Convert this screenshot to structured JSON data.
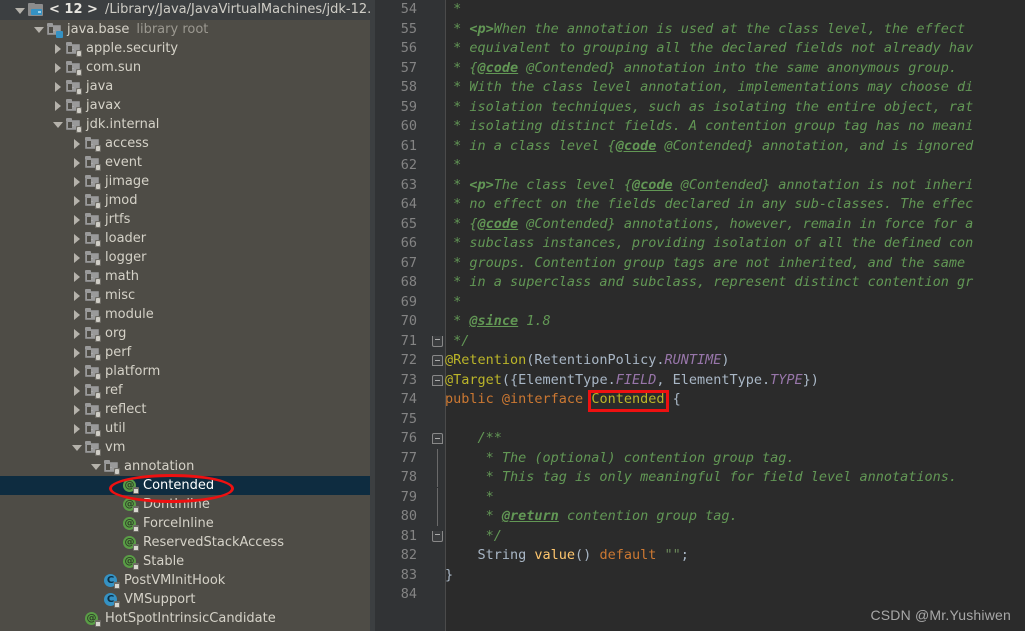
{
  "project_tree": {
    "header": {
      "label": "< 12 >",
      "path": "/Library/Java/JavaVirtualMachines/jdk-12.",
      "icon": "module-icon",
      "arrow": "down"
    },
    "items": [
      {
        "indent": 1,
        "arrow": "down",
        "icon": "library-root-icon",
        "label": "java.base",
        "suffix": "library root"
      },
      {
        "indent": 2,
        "arrow": "right",
        "icon": "package-icon",
        "label": "apple.security",
        "suffix": ""
      },
      {
        "indent": 2,
        "arrow": "right",
        "icon": "package-icon",
        "label": "com.sun",
        "suffix": ""
      },
      {
        "indent": 2,
        "arrow": "right",
        "icon": "package-icon",
        "label": "java",
        "suffix": ""
      },
      {
        "indent": 2,
        "arrow": "right",
        "icon": "package-icon",
        "label": "javax",
        "suffix": ""
      },
      {
        "indent": 2,
        "arrow": "down",
        "icon": "package-icon",
        "label": "jdk.internal",
        "suffix": ""
      },
      {
        "indent": 3,
        "arrow": "right",
        "icon": "package-icon",
        "label": "access",
        "suffix": ""
      },
      {
        "indent": 3,
        "arrow": "right",
        "icon": "package-icon",
        "label": "event",
        "suffix": ""
      },
      {
        "indent": 3,
        "arrow": "right",
        "icon": "package-icon",
        "label": "jimage",
        "suffix": ""
      },
      {
        "indent": 3,
        "arrow": "right",
        "icon": "package-icon",
        "label": "jmod",
        "suffix": ""
      },
      {
        "indent": 3,
        "arrow": "right",
        "icon": "package-icon",
        "label": "jrtfs",
        "suffix": ""
      },
      {
        "indent": 3,
        "arrow": "right",
        "icon": "package-icon",
        "label": "loader",
        "suffix": ""
      },
      {
        "indent": 3,
        "arrow": "right",
        "icon": "package-icon",
        "label": "logger",
        "suffix": ""
      },
      {
        "indent": 3,
        "arrow": "right",
        "icon": "package-icon",
        "label": "math",
        "suffix": ""
      },
      {
        "indent": 3,
        "arrow": "right",
        "icon": "package-icon",
        "label": "misc",
        "suffix": ""
      },
      {
        "indent": 3,
        "arrow": "right",
        "icon": "package-icon",
        "label": "module",
        "suffix": ""
      },
      {
        "indent": 3,
        "arrow": "right",
        "icon": "package-icon",
        "label": "org",
        "suffix": ""
      },
      {
        "indent": 3,
        "arrow": "right",
        "icon": "package-icon",
        "label": "perf",
        "suffix": ""
      },
      {
        "indent": 3,
        "arrow": "right",
        "icon": "package-icon",
        "label": "platform",
        "suffix": ""
      },
      {
        "indent": 3,
        "arrow": "right",
        "icon": "package-icon",
        "label": "ref",
        "suffix": ""
      },
      {
        "indent": 3,
        "arrow": "right",
        "icon": "package-icon",
        "label": "reflect",
        "suffix": ""
      },
      {
        "indent": 3,
        "arrow": "right",
        "icon": "package-icon",
        "label": "util",
        "suffix": ""
      },
      {
        "indent": 3,
        "arrow": "down",
        "icon": "package-icon",
        "label": "vm",
        "suffix": ""
      },
      {
        "indent": 4,
        "arrow": "down",
        "icon": "package-icon",
        "label": "annotation",
        "suffix": ""
      },
      {
        "indent": 5,
        "arrow": "none",
        "icon": "annotation-icon",
        "label": "Contended",
        "suffix": "",
        "selected": true
      },
      {
        "indent": 5,
        "arrow": "none",
        "icon": "annotation-icon",
        "label": "DontInline",
        "suffix": ""
      },
      {
        "indent": 5,
        "arrow": "none",
        "icon": "annotation-icon",
        "label": "ForceInline",
        "suffix": ""
      },
      {
        "indent": 5,
        "arrow": "none",
        "icon": "annotation-icon",
        "label": "ReservedStackAccess",
        "suffix": ""
      },
      {
        "indent": 5,
        "arrow": "none",
        "icon": "annotation-icon",
        "label": "Stable",
        "suffix": ""
      },
      {
        "indent": 4,
        "arrow": "none",
        "icon": "class-icon",
        "label": "PostVMInitHook",
        "suffix": ""
      },
      {
        "indent": 4,
        "arrow": "none",
        "icon": "class-icon",
        "label": "VMSupport",
        "suffix": ""
      },
      {
        "indent": 3,
        "arrow": "none",
        "icon": "annotation-icon",
        "label": "HotSpotIntrinsicCandidate",
        "suffix": ""
      }
    ]
  },
  "editor": {
    "first_line_number": 54,
    "lines": [
      {
        "n": 54,
        "fold": "",
        "tokens": [
          {
            "t": " * ",
            "c": "c-doc"
          }
        ]
      },
      {
        "n": 55,
        "fold": "",
        "tokens": [
          {
            "t": " * ",
            "c": "c-doc"
          },
          {
            "t": "<p>",
            "c": "c-doc-html"
          },
          {
            "t": "When the annotation is used at the class level, the effect",
            "c": "c-doc"
          }
        ]
      },
      {
        "n": 56,
        "fold": "",
        "tokens": [
          {
            "t": " * equivalent to grouping all the declared fields not already hav",
            "c": "c-doc"
          }
        ]
      },
      {
        "n": 57,
        "fold": "",
        "tokens": [
          {
            "t": " * {",
            "c": "c-doc"
          },
          {
            "t": "@code",
            "c": "c-doc-tag"
          },
          {
            "t": " @Contended} annotation into the same anonymous group.",
            "c": "c-doc"
          }
        ]
      },
      {
        "n": 58,
        "fold": "",
        "tokens": [
          {
            "t": " * With the class level annotation, implementations may choose di",
            "c": "c-doc"
          }
        ]
      },
      {
        "n": 59,
        "fold": "",
        "tokens": [
          {
            "t": " * isolation techniques, such as isolating the entire object, rat",
            "c": "c-doc"
          }
        ]
      },
      {
        "n": 60,
        "fold": "",
        "tokens": [
          {
            "t": " * isolating distinct fields. A contention group tag has no meani",
            "c": "c-doc"
          }
        ]
      },
      {
        "n": 61,
        "fold": "",
        "tokens": [
          {
            "t": " * in a class level {",
            "c": "c-doc"
          },
          {
            "t": "@code",
            "c": "c-doc-tag"
          },
          {
            "t": " @Contended} annotation, and is ignored",
            "c": "c-doc"
          }
        ]
      },
      {
        "n": 62,
        "fold": "",
        "tokens": [
          {
            "t": " * ",
            "c": "c-doc"
          }
        ]
      },
      {
        "n": 63,
        "fold": "",
        "tokens": [
          {
            "t": " * ",
            "c": "c-doc"
          },
          {
            "t": "<p>",
            "c": "c-doc-html"
          },
          {
            "t": "The class level {",
            "c": "c-doc"
          },
          {
            "t": "@code",
            "c": "c-doc-tag"
          },
          {
            "t": " @Contended} annotation is not inheri",
            "c": "c-doc"
          }
        ]
      },
      {
        "n": 64,
        "fold": "",
        "tokens": [
          {
            "t": " * no effect on the fields declared in any sub-classes. The effec",
            "c": "c-doc"
          }
        ]
      },
      {
        "n": 65,
        "fold": "",
        "tokens": [
          {
            "t": " * {",
            "c": "c-doc"
          },
          {
            "t": "@code",
            "c": "c-doc-tag"
          },
          {
            "t": " @Contended} annotations, however, remain in force for a",
            "c": "c-doc"
          }
        ]
      },
      {
        "n": 66,
        "fold": "",
        "tokens": [
          {
            "t": " * subclass instances, providing isolation of all the defined con",
            "c": "c-doc"
          }
        ]
      },
      {
        "n": 67,
        "fold": "",
        "tokens": [
          {
            "t": " * groups. Contention group tags are not inherited, and the same",
            "c": "c-doc"
          }
        ]
      },
      {
        "n": 68,
        "fold": "",
        "tokens": [
          {
            "t": " * in a superclass and subclass, represent distinct contention gr",
            "c": "c-doc"
          }
        ]
      },
      {
        "n": 69,
        "fold": "",
        "tokens": [
          {
            "t": " * ",
            "c": "c-doc"
          }
        ]
      },
      {
        "n": 70,
        "fold": "",
        "tokens": [
          {
            "t": " * ",
            "c": "c-doc"
          },
          {
            "t": "@since",
            "c": "c-doc-tag"
          },
          {
            "t": " 1.8",
            "c": "c-doc"
          }
        ]
      },
      {
        "n": 71,
        "fold": "end",
        "tokens": [
          {
            "t": " */",
            "c": "c-doc"
          }
        ]
      },
      {
        "n": 72,
        "fold": "start",
        "tokens": [
          {
            "t": "@Retention",
            "c": "c-anno"
          },
          {
            "t": "(RetentionPolicy.",
            "c": "c-plain"
          },
          {
            "t": "RUNTIME",
            "c": "c-static"
          },
          {
            "t": ")",
            "c": "c-plain"
          }
        ]
      },
      {
        "n": 73,
        "fold": "start",
        "tokens": [
          {
            "t": "@Target",
            "c": "c-anno"
          },
          {
            "t": "({ElementType.",
            "c": "c-plain"
          },
          {
            "t": "FIELD",
            "c": "c-static"
          },
          {
            "t": ", ElementType.",
            "c": "c-plain"
          },
          {
            "t": "TYPE",
            "c": "c-static"
          },
          {
            "t": "})",
            "c": "c-plain"
          }
        ]
      },
      {
        "n": 74,
        "fold": "",
        "tokens": [
          {
            "t": "public ",
            "c": "c-kw"
          },
          {
            "t": "@interface ",
            "c": "c-kw"
          },
          {
            "t": "Contended",
            "c": "hl-name"
          },
          {
            "t": " {",
            "c": "c-plain"
          }
        ]
      },
      {
        "n": 75,
        "fold": "",
        "tokens": []
      },
      {
        "n": 76,
        "fold": "start",
        "tokens": [
          {
            "t": "    /**",
            "c": "c-doc"
          }
        ]
      },
      {
        "n": 77,
        "fold": "mid",
        "tokens": [
          {
            "t": "     * The (optional) contention group tag.",
            "c": "c-doc"
          }
        ]
      },
      {
        "n": 78,
        "fold": "mid",
        "tokens": [
          {
            "t": "     * This tag is only meaningful for field level annotations.",
            "c": "c-doc"
          }
        ]
      },
      {
        "n": 79,
        "fold": "mid",
        "tokens": [
          {
            "t": "     *",
            "c": "c-doc"
          }
        ]
      },
      {
        "n": 80,
        "fold": "mid",
        "tokens": [
          {
            "t": "     * ",
            "c": "c-doc"
          },
          {
            "t": "@return",
            "c": "c-doc-tag"
          },
          {
            "t": " contention group tag.",
            "c": "c-doc"
          }
        ]
      },
      {
        "n": 81,
        "fold": "end",
        "tokens": [
          {
            "t": "     */",
            "c": "c-doc"
          }
        ]
      },
      {
        "n": 82,
        "fold": "",
        "tokens": [
          {
            "t": "    String ",
            "c": "c-ident"
          },
          {
            "t": "value",
            "c": "c-method"
          },
          {
            "t": "() ",
            "c": "c-plain"
          },
          {
            "t": "default ",
            "c": "c-kw"
          },
          {
            "t": "\"\"",
            "c": "c-str"
          },
          {
            "t": ";",
            "c": "c-plain"
          }
        ]
      },
      {
        "n": 83,
        "fold": "",
        "tokens": [
          {
            "t": "}",
            "c": "c-plain"
          }
        ]
      },
      {
        "n": 84,
        "fold": "",
        "tokens": []
      }
    ],
    "highlight_box": {
      "text": "Contended",
      "color": "#ee1111"
    }
  },
  "watermark": {
    "text": "CSDN @Mr.Yushiwen"
  },
  "colors": {
    "tree_background": "#4e4c46",
    "tree_header_background": "#3c3f41",
    "selection_background": "#0e2c40",
    "editor_background": "#2b2b2b",
    "gutter_background": "#313335",
    "annotation_red": "#ee1111",
    "javadoc_green": "#629755",
    "annotation_yellow": "#bbb529",
    "keyword_orange": "#cc7832",
    "static_purple": "#9876aa",
    "method_gold": "#ffc66d"
  }
}
